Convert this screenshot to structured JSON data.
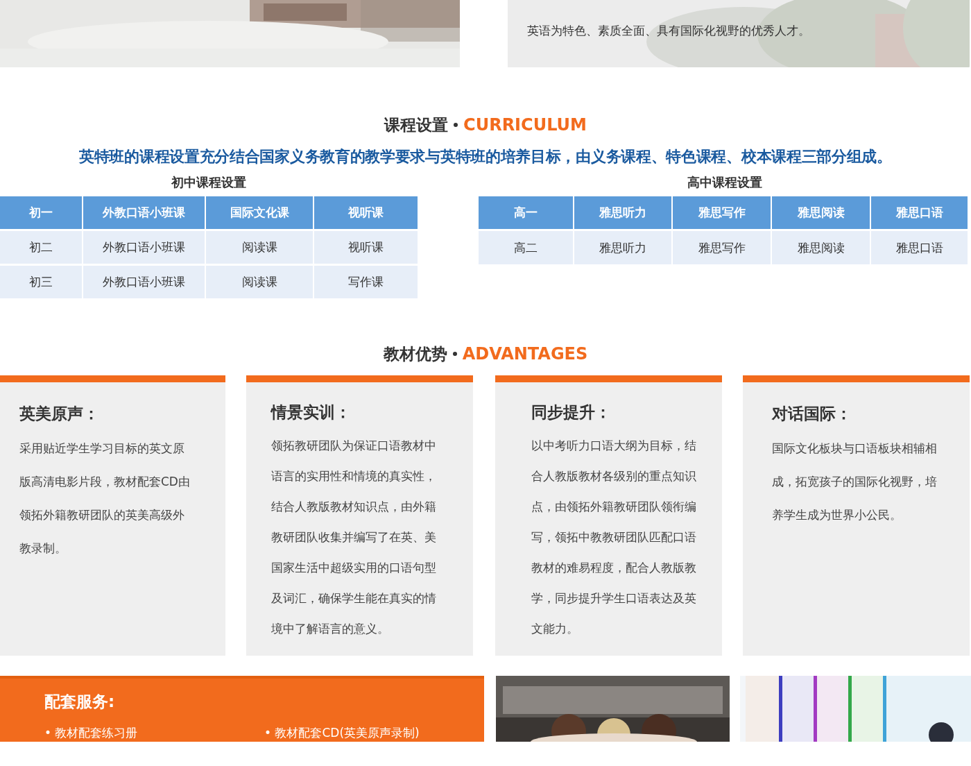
{
  "intro": {
    "text": "英语为特色、素质全面、具有国际化视野的优秀人才。"
  },
  "curriculum": {
    "title": "课程设置",
    "title_en": "CURRICULUM",
    "summary": "英特班的课程设置充分结合国家义务教育的教学要求与英特班的培养目标，由义务课程、特色课程、校本课程三部分组成。",
    "tables": [
      {
        "caption": "初中课程设置",
        "rows": [
          {
            "kind": "header",
            "cells": [
              "初一",
              "外教口语小班课",
              "国际文化课",
              "视听课"
            ]
          },
          {
            "kind": "body",
            "cells": [
              "初二",
              "外教口语小班课",
              "阅读课",
              "视听课"
            ]
          },
          {
            "kind": "body",
            "cells": [
              "初三",
              "外教口语小班课",
              "阅读课",
              "写作课"
            ]
          }
        ]
      },
      {
        "caption": "高中课程设置",
        "rows": [
          {
            "kind": "header",
            "cells": [
              "高一",
              "雅思听力",
              "雅思写作",
              "雅思阅读",
              "雅思口语"
            ]
          },
          {
            "kind": "body",
            "cells": [
              "高二",
              "雅思听力",
              "雅思写作",
              "雅思阅读",
              "雅思口语"
            ]
          }
        ]
      }
    ]
  },
  "advantages": {
    "title": "教材优势",
    "title_en": "ADVANTAGES",
    "cards": [
      {
        "heading": "英美原声：",
        "lines": [
          "采用贴近学生学习目标的英文原",
          "版高清电影片段，教材配套CD由",
          "领拓外籍教研团队的英美高级外",
          "教录制。"
        ]
      },
      {
        "heading": "情景实训：",
        "lines": [
          "领拓教研团队为保证口语教材中",
          "语言的实用性和情境的真实性，",
          "结合人教版教材知识点，由外籍",
          "教研团队收集并编写了在英、美",
          "国家生活中超级实用的口语句型",
          "及词汇，确保学生能在真实的情",
          "境中了解语言的意义。"
        ]
      },
      {
        "heading": "同步提升：",
        "lines": [
          "以中考听力口语大纲为目标，结",
          "合人教版教材各级别的重点知识",
          "点，由领拓外籍教研团队领衔编",
          "写，领拓中教教研团队匹配口语",
          "教材的难易程度，配合人教版教",
          "学，同步提升学生口语表达及英",
          "文能力。"
        ]
      },
      {
        "heading": "对话国际：",
        "lines": [
          "国际文化板块与口语板块相辅相",
          "成，拓宽孩子的国际化视野，培",
          "养学生成为世界小公民。"
        ]
      }
    ]
  },
  "services": {
    "title": "配套服务:",
    "items": [
      "• 教材配套练习册",
      "• 教材配套CD(英美原声录制)"
    ]
  }
}
